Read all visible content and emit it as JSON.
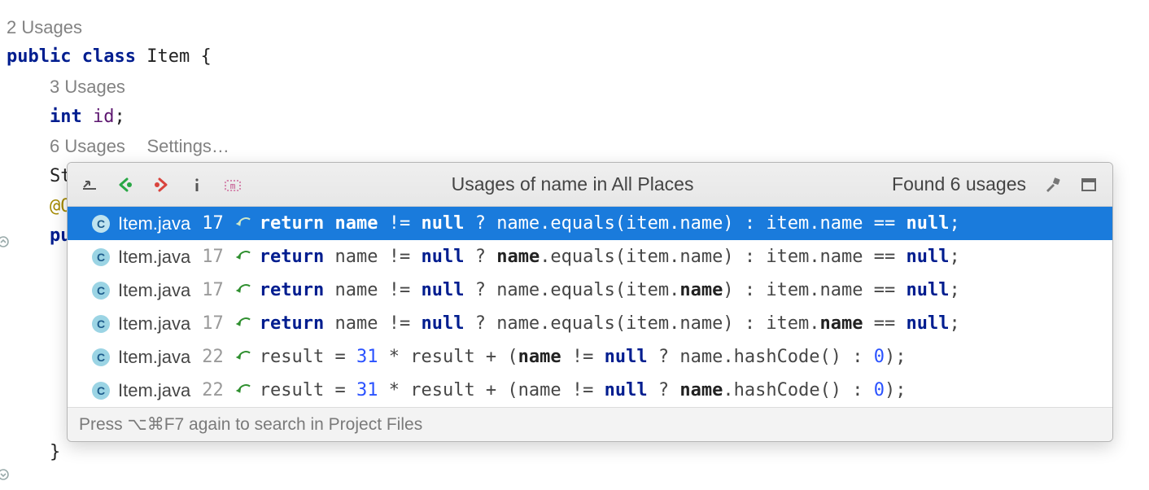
{
  "editor": {
    "inlay_top": "2 Usages",
    "line_public": "public",
    "line_class": "class",
    "line_item": "Item",
    "line_brace_open": "{",
    "inlay_3": "3 Usages",
    "line_int": "int",
    "line_id": "id",
    "line_semicolon": ";",
    "inlay_6": "6 Usages",
    "inlay_settings": "Settings…",
    "line_st_prefix": "St",
    "line_at_o": "@O",
    "line_pu": "pu",
    "line_brace_close": "}"
  },
  "popup": {
    "title": "Usages of name in All Places",
    "count": "Found 6 usages",
    "footer": "Press ⌥⌘F7 again to search in Project Files",
    "usages": [
      {
        "file": "Item.java",
        "line": "17",
        "code_html": "<span class='c-kw'>return</span> <span class='c-bold'>name</span> != <span class='c-null'>null</span> ? name.equals(item.name) : item.name == <span class='c-null'>null</span>;",
        "selected": true,
        "arrow": "write"
      },
      {
        "file": "Item.java",
        "line": "17",
        "code_html": "<span class='c-kw'>return</span> name != <span class='c-null'>null</span> ? <span class='c-bold'>name</span>.equals(item.name) : item.name == <span class='c-null'>null</span>;",
        "selected": false,
        "arrow": "read"
      },
      {
        "file": "Item.java",
        "line": "17",
        "code_html": "<span class='c-kw'>return</span> name != <span class='c-null'>null</span> ? name.equals(item.<span class='c-bold'>name</span>) : item.name == <span class='c-null'>null</span>;",
        "selected": false,
        "arrow": "read"
      },
      {
        "file": "Item.java",
        "line": "17",
        "code_html": "<span class='c-kw'>return</span> name != <span class='c-null'>null</span> ? name.equals(item.name) : item.<span class='c-bold'>name</span> == <span class='c-null'>null</span>;",
        "selected": false,
        "arrow": "read"
      },
      {
        "file": "Item.java",
        "line": "22",
        "code_html": "result = <span class='c-num'>31</span> * result + (<span class='c-bold'>name</span> != <span class='c-null'>null</span> ? name.hashCode() : <span class='c-num'>0</span>);",
        "selected": false,
        "arrow": "read"
      },
      {
        "file": "Item.java",
        "line": "22",
        "code_html": "result = <span class='c-num'>31</span> * result + (name != <span class='c-null'>null</span> ? <span class='c-bold'>name</span>.hashCode() : <span class='c-num'>0</span>);",
        "selected": false,
        "arrow": "read"
      }
    ]
  },
  "icons": {
    "scroll_from": "scroll-from-source",
    "prev": "previous-occurrence",
    "next": "next-occurrence",
    "info": "quick-definition",
    "regex": "method-separator",
    "wrench": "settings",
    "pin": "pin"
  }
}
